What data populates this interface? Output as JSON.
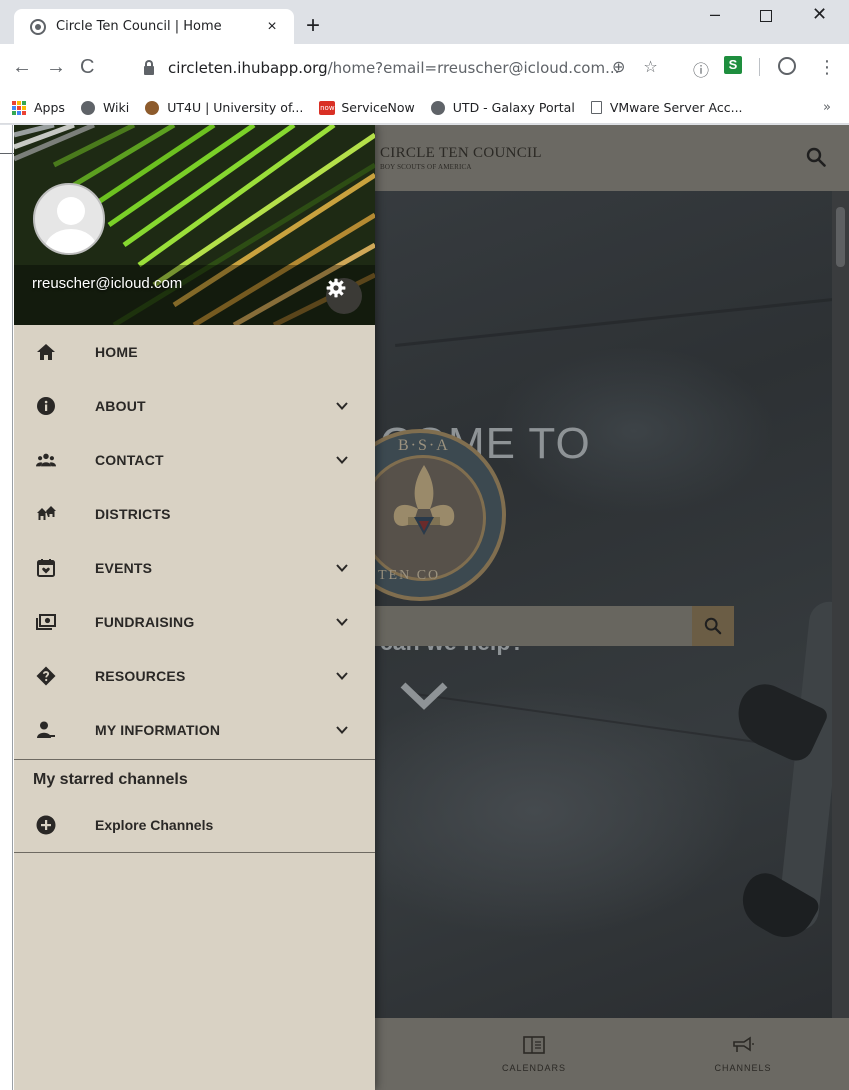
{
  "browser": {
    "tab_title": "Circle Ten Council | Home",
    "tab_close": "×",
    "new_tab": "+",
    "url_host": "circleten.ihubapp.org",
    "url_path": "/home?email=rreuscher@icloud.com...",
    "bookmarks": [
      {
        "label": "Apps",
        "icon": "apps-grid-icon"
      },
      {
        "label": "Wiki",
        "icon": "globe-icon"
      },
      {
        "label": "UT4U | University of...",
        "icon": "seal-icon"
      },
      {
        "label": "ServiceNow",
        "icon": "servicenow-icon",
        "badge": "now"
      },
      {
        "label": "UTD - Galaxy Portal",
        "icon": "globe-icon"
      },
      {
        "label": "VMware Server Acc...",
        "icon": "page-icon"
      }
    ],
    "bookmarks_more": "»"
  },
  "app": {
    "brand_line1": "CIRCLE TEN COUNCIL",
    "brand_line2": "BOY SCOUTS OF AMERICA",
    "hero_welcome": "COME TO",
    "hero_help": "can we help?",
    "seal_top": "B·S·A",
    "seal_bottom": "TEN CO",
    "bottom_nav": [
      {
        "label": "CALENDARS",
        "icon": "calendar-icon"
      },
      {
        "label": "CHANNELS",
        "icon": "megaphone-icon"
      }
    ]
  },
  "drawer": {
    "user_email": "rreuscher@icloud.com",
    "menu": [
      {
        "label": "HOME",
        "icon": "home-icon",
        "expandable": false
      },
      {
        "label": "ABOUT",
        "icon": "info-icon",
        "expandable": true
      },
      {
        "label": "CONTACT",
        "icon": "people-icon",
        "expandable": true
      },
      {
        "label": "DISTRICTS",
        "icon": "houses-icon",
        "expandable": false
      },
      {
        "label": "EVENTS",
        "icon": "calendar-heart-icon",
        "expandable": true
      },
      {
        "label": "FUNDRAISING",
        "icon": "money-icon",
        "expandable": true
      },
      {
        "label": "RESOURCES",
        "icon": "diamond-question-icon",
        "expandable": true
      },
      {
        "label": "MY INFORMATION",
        "icon": "person-icon",
        "expandable": true
      }
    ],
    "starred_title": "My starred channels",
    "explore_label": "Explore Channels"
  },
  "colors": {
    "drawer_bg": "#d9d2c4",
    "header_bar": "#6b6963",
    "accent_gold": "#806e4f"
  }
}
